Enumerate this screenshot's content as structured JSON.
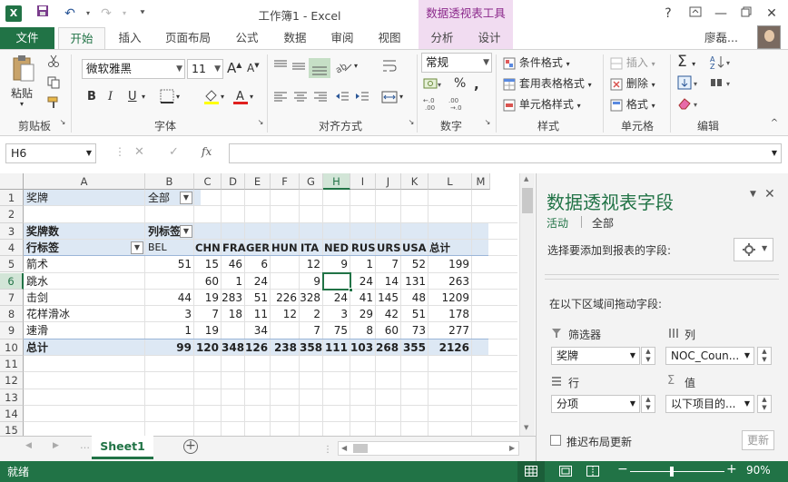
{
  "title_bar": {
    "app_icon": "X",
    "title": "工作簿1 - Excel",
    "contextual_header": "数据透视表工具",
    "help": "?",
    "minimize": "—",
    "close": "✕"
  },
  "tabs": {
    "file": "文件",
    "home": "开始",
    "insert": "插入",
    "page_layout": "页面布局",
    "formulas": "公式",
    "data": "数据",
    "review": "审阅",
    "view": "视图",
    "analyze": "分析",
    "design": "设计"
  },
  "user": {
    "name": "廖磊..."
  },
  "ribbon": {
    "clipboard": {
      "paste": "粘贴",
      "label": "剪贴板"
    },
    "font": {
      "name": "微软雅黑",
      "size": "11",
      "bold": "B",
      "italic": "I",
      "underline": "U",
      "grow": "A",
      "shrink": "A",
      "label": "字体"
    },
    "alignment": {
      "label": "对齐方式"
    },
    "number": {
      "format": "常规",
      "label": "数字"
    },
    "styles": {
      "conditional": "条件格式",
      "table": "套用表格格式",
      "cell_styles": "单元格样式",
      "label": "样式"
    },
    "cells": {
      "insert": "插入",
      "delete": "删除",
      "format": "格式",
      "label": "单元格"
    },
    "editing": {
      "label": "编辑"
    }
  },
  "formula_bar": {
    "name_box": "H6",
    "cancel": "✕",
    "enter": "✓",
    "fx": "fx",
    "value": ""
  },
  "grid": {
    "columns": [
      "A",
      "B",
      "C",
      "D",
      "E",
      "F",
      "G",
      "H",
      "I",
      "J",
      "K",
      "L",
      "M"
    ],
    "rows": [
      "1",
      "2",
      "3",
      "4",
      "5",
      "6",
      "7",
      "8",
      "9",
      "10",
      "11",
      "12",
      "13",
      "14",
      "15"
    ],
    "filter_label": "奖牌",
    "filter_value": "全部",
    "values_label": "奖牌数",
    "col_labels": "列标签",
    "row_labels": "行标签",
    "headers": [
      "BEL",
      "CHN",
      "FRA",
      "GER",
      "HUN",
      "ITA",
      "NED",
      "RUS",
      "URS",
      "USA",
      "总计"
    ],
    "data_rows": [
      {
        "name": "箭术",
        "values": [
          "51",
          "15",
          "46",
          "6",
          "",
          "12",
          "9",
          "1",
          "7",
          "52",
          "199"
        ]
      },
      {
        "name": "跳水",
        "values": [
          "",
          "60",
          "1",
          "24",
          "",
          "9",
          "",
          "24",
          "14",
          "131",
          "263"
        ]
      },
      {
        "name": "击剑",
        "values": [
          "44",
          "19",
          "283",
          "51",
          "226",
          "328",
          "24",
          "41",
          "145",
          "48",
          "1209"
        ]
      },
      {
        "name": "花样滑冰",
        "values": [
          "3",
          "7",
          "18",
          "11",
          "12",
          "2",
          "3",
          "29",
          "42",
          "51",
          "178"
        ]
      },
      {
        "name": "速滑",
        "values": [
          "1",
          "19",
          "",
          "34",
          "",
          "7",
          "75",
          "8",
          "60",
          "73",
          "277"
        ]
      }
    ],
    "total_row": {
      "name": "总计",
      "values": [
        "99",
        "120",
        "348",
        "126",
        "238",
        "358",
        "111",
        "103",
        "268",
        "355",
        "2126"
      ]
    }
  },
  "sheet_tab": "Sheet1",
  "status": {
    "text": "就绪",
    "zoom": "90%"
  },
  "pivot_pane": {
    "title": "数据透视表字段",
    "tab_active": "活动",
    "tab_all": "全部",
    "choose_fields": "选择要添加到报表的字段:",
    "drag_hint": "在以下区域间拖动字段:",
    "filters_label": "筛选器",
    "columns_label": "列",
    "rows_label": "行",
    "values_label": "值",
    "filters_field": "奖牌",
    "columns_field": "NOC_Coun...",
    "rows_field": "分项",
    "values_field": "以下项目的...",
    "defer_label": "推迟布局更新",
    "update_button": "更新"
  }
}
